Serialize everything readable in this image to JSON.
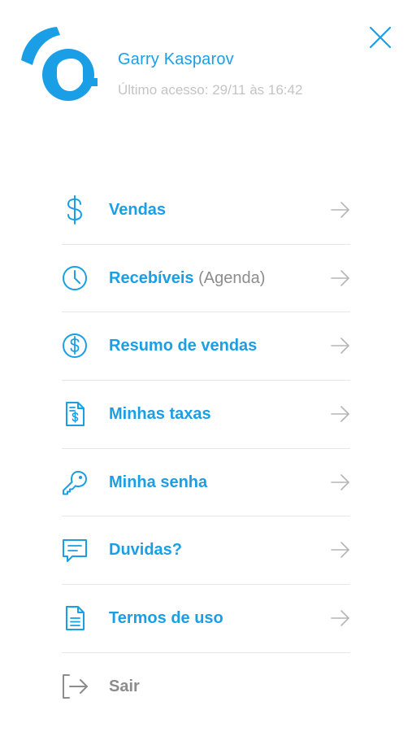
{
  "brand": {
    "logo_icon": "e-logo-icon",
    "accent_color": "#1a9fe6"
  },
  "user": {
    "name": "Garry Kasparov",
    "last_access": "Último acesso: 29/11 às 16:42"
  },
  "close_icon": "close-icon",
  "menu": [
    {
      "label": "Vendas",
      "suffix": "",
      "icon": "dollar-sign-icon"
    },
    {
      "label": "Recebíveis",
      "suffix": " (Agenda)",
      "icon": "clock-icon"
    },
    {
      "label": "Resumo de vendas",
      "suffix": "",
      "icon": "dollar-circle-icon"
    },
    {
      "label": "Minhas taxas",
      "suffix": "",
      "icon": "fee-document-icon"
    },
    {
      "label": "Minha senha",
      "suffix": "",
      "icon": "key-icon"
    },
    {
      "label": "Duvidas?",
      "suffix": "",
      "icon": "chat-icon"
    },
    {
      "label": "Termos de uso",
      "suffix": "",
      "icon": "document-icon"
    }
  ],
  "logout": {
    "label": "Sair",
    "icon": "logout-icon"
  },
  "arrow_icon": "arrow-right-icon"
}
